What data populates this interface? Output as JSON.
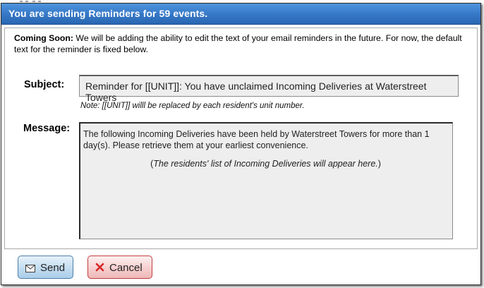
{
  "dialog": {
    "title": "You are sending Reminders for 59 events."
  },
  "notice": {
    "label": "Coming Soon:",
    "text": " We will be adding the ability to edit the text of your email reminders in the future. For now, the default text for the reminder is fixed below."
  },
  "subject": {
    "label": "Subject:",
    "value": "Reminder for [[UNIT]]: You have unclaimed Incoming Deliveries at Waterstreet Towers",
    "note": "Note: [[UNIT]] willl be replaced by each resident's unit number."
  },
  "message": {
    "label": "Message:",
    "body": "The following Incoming Deliveries have been held by Waterstreet Towers for more than 1 day(s). Please retrieve them at your earliest convenience.",
    "placeholder_open": "(",
    "placeholder_text": "The residents' list of Incoming Deliveries will appear here.",
    "placeholder_close": ")"
  },
  "buttons": {
    "send": {
      "label": "Send",
      "icon": "envelope-icon",
      "color": "#c3ddf1"
    },
    "cancel": {
      "label": "Cancel",
      "icon": "close-icon",
      "color": "#f6cfcf",
      "icon_color": "#d42a2a"
    }
  },
  "colors": {
    "titlebar": "#3779c8",
    "field_background": "#eeeeee"
  }
}
